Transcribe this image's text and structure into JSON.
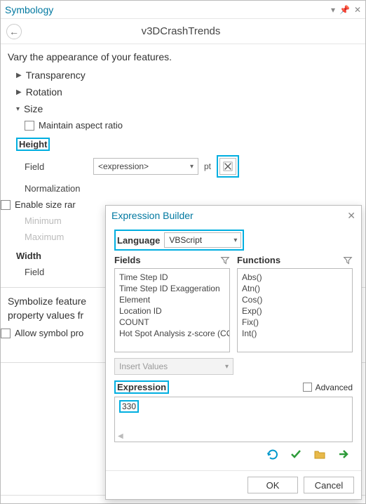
{
  "pane": {
    "title": "Symbology",
    "layer_name": "v3DCrashTrends",
    "description": "Vary the appearance of your features."
  },
  "sections": {
    "transparency": "Transparency",
    "rotation": "Rotation",
    "size": "Size"
  },
  "size": {
    "maintain_aspect": "Maintain aspect ratio",
    "height_label": "Height",
    "field_label": "Field",
    "field_value": "<expression>",
    "field_unit": "pt",
    "normalization_label": "Normalization",
    "enable_size_range": "Enable size rar",
    "min_label": "Minimum",
    "max_label": "Maximum",
    "width_label": "Width",
    "width_field_label": "Field"
  },
  "symbolize_text_1": "Symbolize feature",
  "symbolize_text_2": "property values fr",
  "allow_prop": "Allow symbol pro",
  "dialog": {
    "title": "Expression Builder",
    "language_label": "Language",
    "language_value": "VBScript",
    "fields_label": "Fields",
    "functions_label": "Functions",
    "fields_list": [
      "Time Step ID",
      "Time Step ID Exaggeration",
      "Element",
      "Location ID",
      "COUNT",
      "Hot Spot Analysis z-score (COU"
    ],
    "functions_list": [
      "Abs()",
      "Atn()",
      "Cos()",
      "Exp()",
      "Fix()",
      "Int()"
    ],
    "insert_values": "Insert Values",
    "expression_label": "Expression",
    "advanced_label": "Advanced",
    "expression_value": "330",
    "ok": "OK",
    "cancel": "Cancel"
  }
}
